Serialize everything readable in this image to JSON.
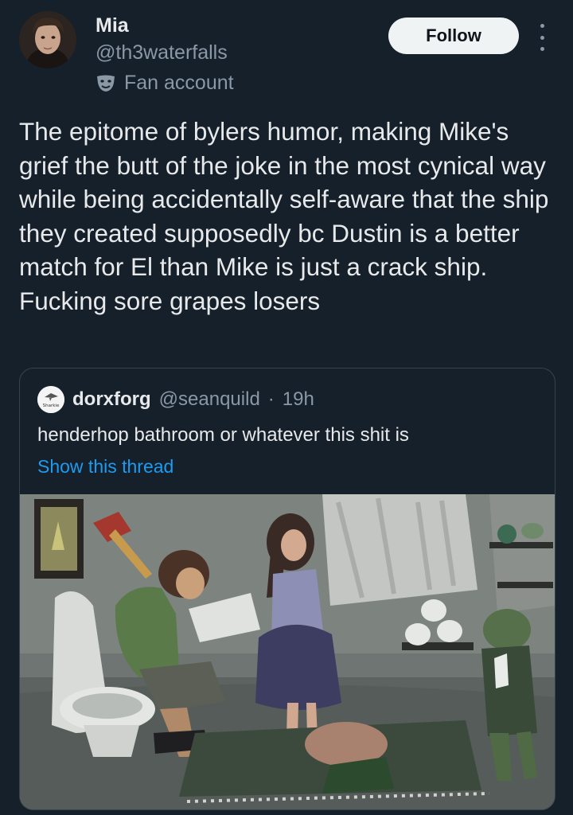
{
  "author": {
    "name": "Mia",
    "handle": "@th3waterfalls",
    "label": "Fan account",
    "label_icon": "theater-masks-icon",
    "avatar_icon": "avatar-icon"
  },
  "actions": {
    "follow_label": "Follow",
    "more_icon": "more-vertical-icon"
  },
  "tweet": {
    "text": "The epitome of bylers humor, making Mike's grief the butt of the joke in the most cynical way while being accidentally self-aware that the ship they created supposedly bc Dustin is a better match for El than Mike is just a crack ship. Fucking sore grapes losers"
  },
  "quoted_tweet": {
    "author_name": "dorxforg",
    "author_handle": "@seanquild",
    "separator": "·",
    "time": "19h",
    "text": "henderhop bathroom or whatever this shit is",
    "show_thread": "Show this thread",
    "avatar_text": "Sharkie",
    "image_icon": "painting-image"
  },
  "colors": {
    "background": "#15202b",
    "text": "#e7e9ea",
    "secondary": "#8b98a5",
    "link": "#1d9bf0",
    "border": "#38444d",
    "follow_bg": "#eff3f4"
  }
}
